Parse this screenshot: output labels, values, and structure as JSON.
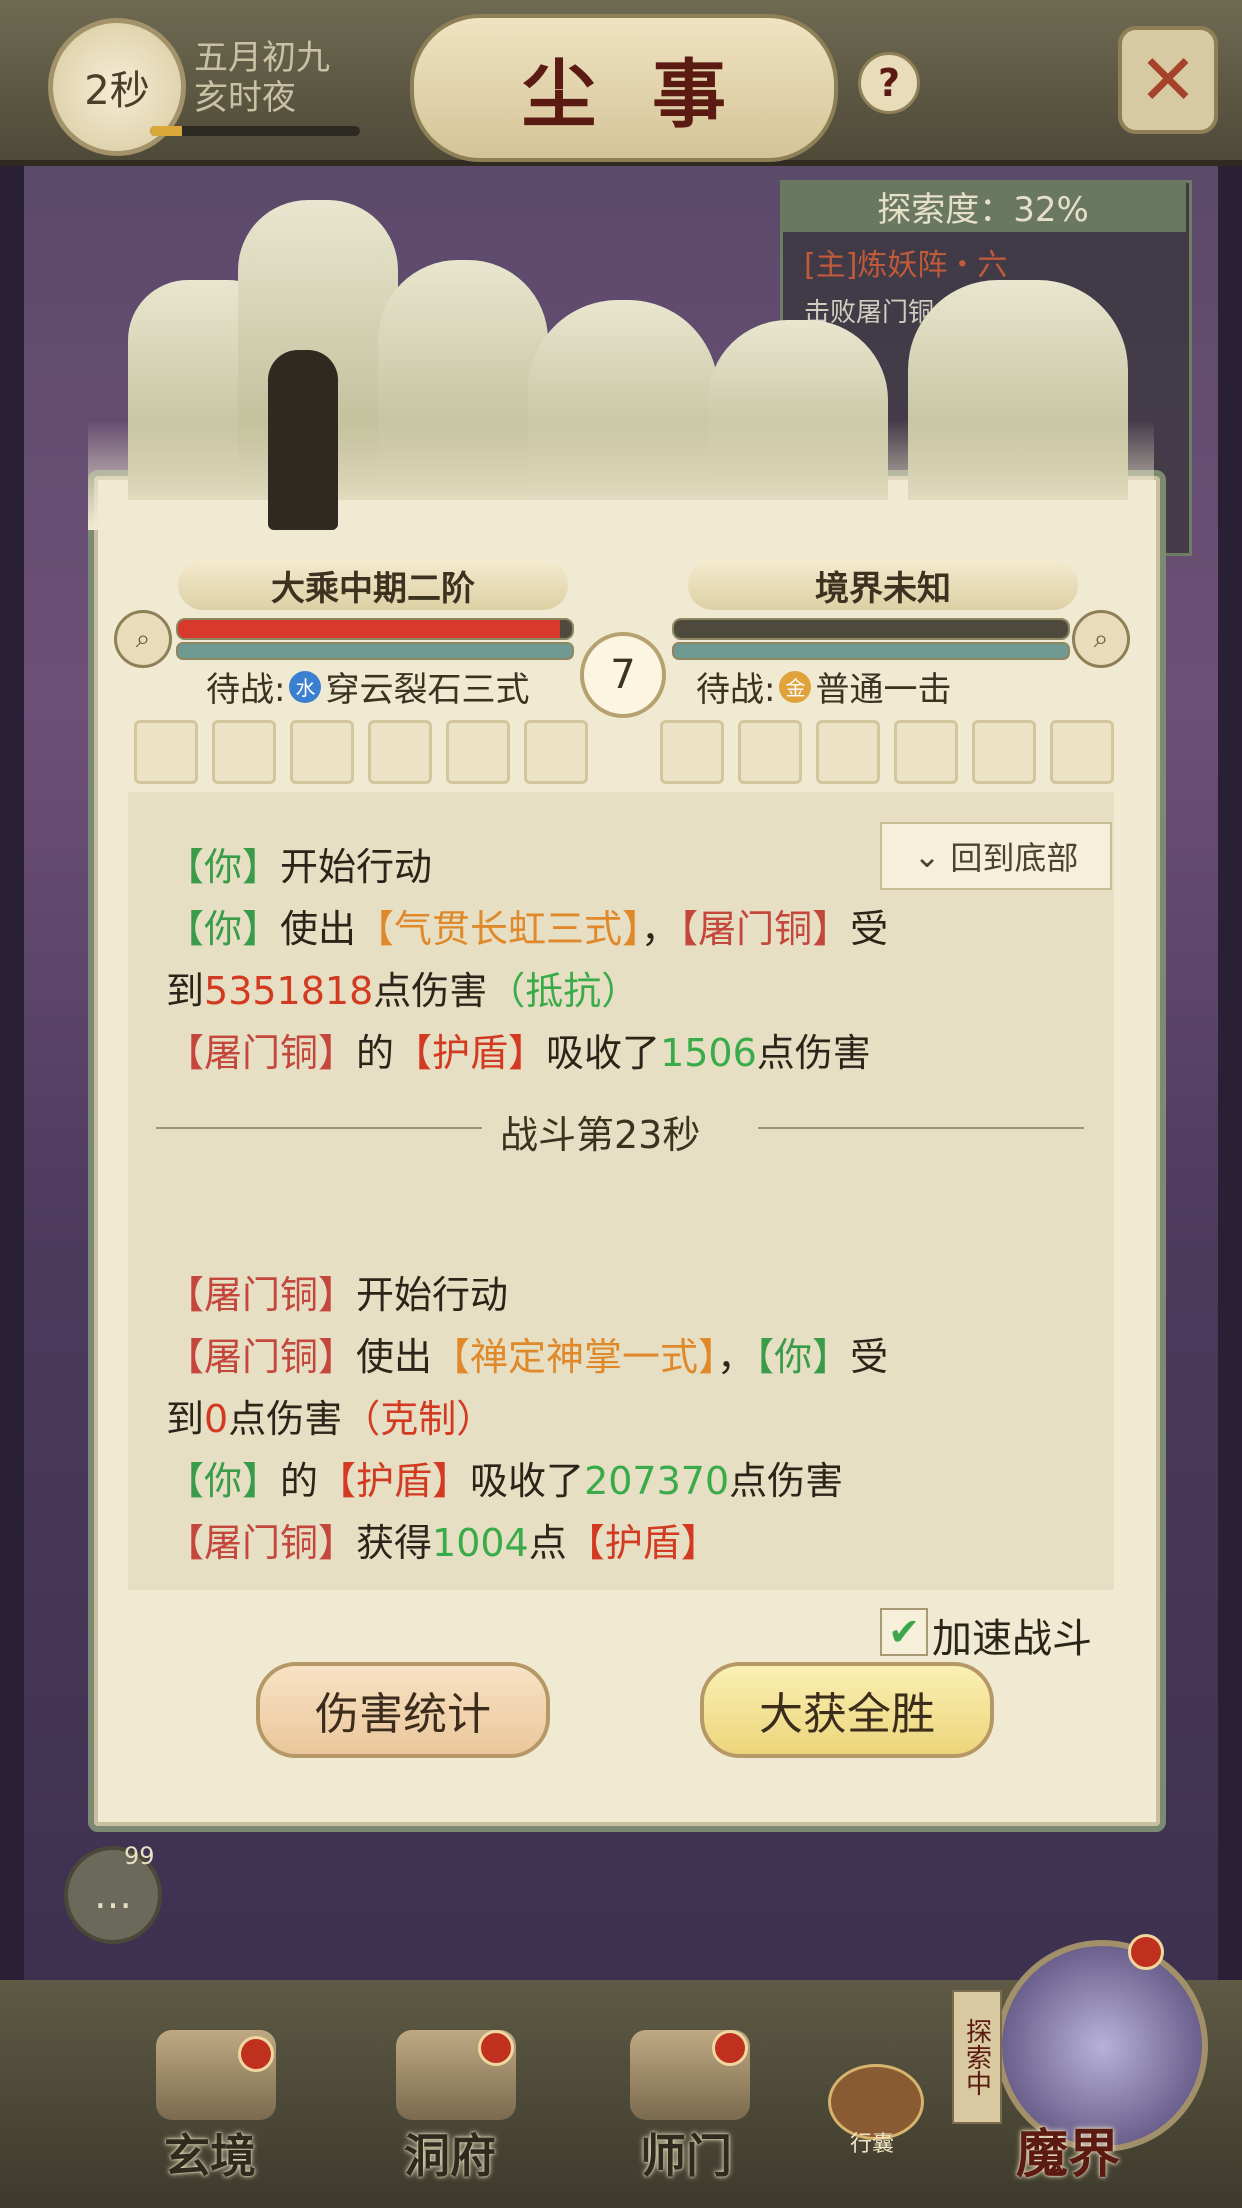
{
  "header": {
    "timer": "2秒",
    "date_line1": "五月初九",
    "date_line2": "亥时夜",
    "title": "尘事",
    "help": "?",
    "close": "✕",
    "progress": 0.15
  },
  "explore": {
    "label": "探索度：32%",
    "quest1": "[主]炼妖阵・六",
    "quest2": "击败屠门铜"
  },
  "battle": {
    "player_name": "大乘中期二阶",
    "enemy_name": "境界未知",
    "round": "7",
    "player_wait_prefix": "待战:",
    "player_element": "水",
    "player_skill": "穿云裂石三式",
    "enemy_wait_prefix": "待战:",
    "enemy_element": "金",
    "enemy_skill": "普通一击",
    "player_hp": 0.97,
    "enemy_hp": 1.0,
    "colors": {
      "element_water": "#3b7fd0",
      "element_gold": "#e0a33b"
    }
  },
  "log": {
    "back_to_bottom": "回到底部",
    "separator": "战斗第23秒",
    "l1_a": "【你】",
    "l1_b": "开始行动",
    "l2_a": "【你】",
    "l2_b": "使出",
    "l2_c": "【气贯长虹三式】",
    "l2_d": "，",
    "l2_e": "【屠门铜】",
    "l2_f": "受",
    "l3_a": "到",
    "l3_b": "5351818",
    "l3_c": "点伤害",
    "l3_d": "（抵抗）",
    "l4_a": "【屠门铜】",
    "l4_b": "的",
    "l4_c": "【护盾】",
    "l4_d": "吸收了",
    "l4_e": "1506",
    "l4_f": "点伤害",
    "l5_a": "【屠门铜】",
    "l5_b": "开始行动",
    "l6_a": "【屠门铜】",
    "l6_b": "使出",
    "l6_c": "【禅定神掌一式】",
    "l6_d": "，",
    "l6_e": "【你】",
    "l6_f": "受",
    "l7_a": "到",
    "l7_b": "0",
    "l7_c": "点伤害",
    "l7_d": "（克制）",
    "l8_a": "【你】",
    "l8_b": "的",
    "l8_c": "【护盾】",
    "l8_d": "吸收了",
    "l8_e": "207370",
    "l8_f": "点伤害",
    "l9_a": "【屠门铜】",
    "l9_b": "获得",
    "l9_c": "1004",
    "l9_d": "点",
    "l9_e": "【护盾】"
  },
  "controls": {
    "speed_label": "加速战斗",
    "speed_checked": true,
    "damage_stats": "伤害统计",
    "victory": "大获全胜"
  },
  "chat": {
    "count": "99"
  },
  "nav": {
    "item1": "玄境",
    "item2": "洞府",
    "item3": "师门",
    "bag": "行囊",
    "exploring": "探索中",
    "item5": "魔界"
  }
}
